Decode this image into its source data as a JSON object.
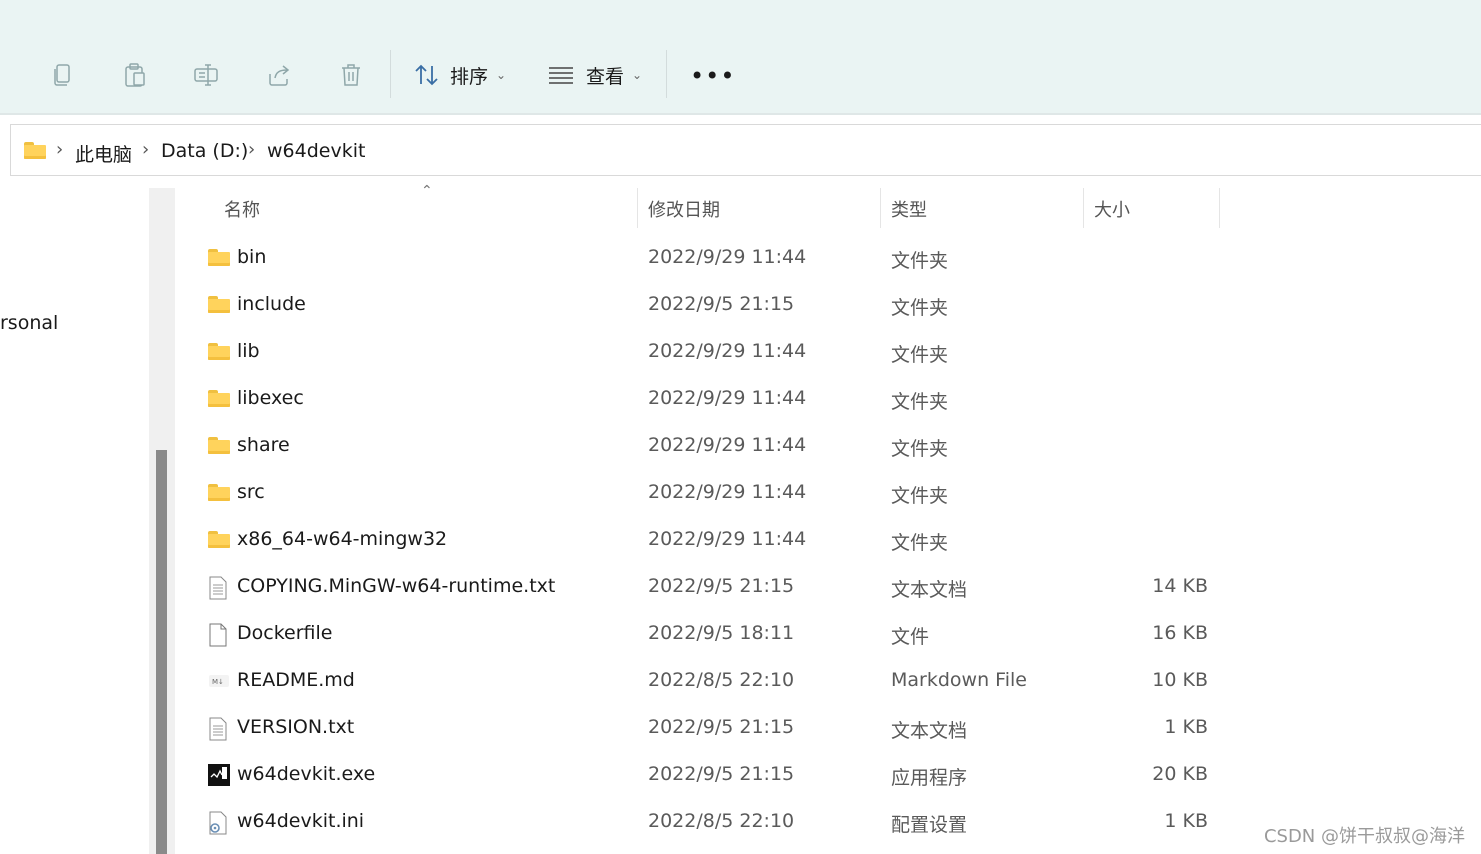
{
  "toolbar": {
    "sort_label": "排序",
    "view_label": "查看",
    "more_label": "•••"
  },
  "breadcrumb": {
    "items": [
      "此电脑",
      "Data (D:)",
      "w64devkit"
    ],
    "separator": "›"
  },
  "nav_pane": {
    "partial_item": "rsonal"
  },
  "columns": {
    "name": "名称",
    "date": "修改日期",
    "type": "类型",
    "size": "大小"
  },
  "files": [
    {
      "name": "bin",
      "date": "2022/9/29 11:44",
      "type": "文件夹",
      "size": "",
      "icon": "folder-icon"
    },
    {
      "name": "include",
      "date": "2022/9/5 21:15",
      "type": "文件夹",
      "size": "",
      "icon": "folder-icon"
    },
    {
      "name": "lib",
      "date": "2022/9/29 11:44",
      "type": "文件夹",
      "size": "",
      "icon": "folder-icon"
    },
    {
      "name": "libexec",
      "date": "2022/9/29 11:44",
      "type": "文件夹",
      "size": "",
      "icon": "folder-icon"
    },
    {
      "name": "share",
      "date": "2022/9/29 11:44",
      "type": "文件夹",
      "size": "",
      "icon": "folder-icon"
    },
    {
      "name": "src",
      "date": "2022/9/29 11:44",
      "type": "文件夹",
      "size": "",
      "icon": "folder-icon"
    },
    {
      "name": "x86_64-w64-mingw32",
      "date": "2022/9/29 11:44",
      "type": "文件夹",
      "size": "",
      "icon": "folder-icon"
    },
    {
      "name": "COPYING.MinGW-w64-runtime.txt",
      "date": "2022/9/5 21:15",
      "type": "文本文档",
      "size": "14 KB",
      "icon": "text-file-icon"
    },
    {
      "name": "Dockerfile",
      "date": "2022/9/5 18:11",
      "type": "文件",
      "size": "16 KB",
      "icon": "blank-file-icon"
    },
    {
      "name": "README.md",
      "date": "2022/8/5 22:10",
      "type": "Markdown File",
      "size": "10 KB",
      "icon": "markdown-file-icon"
    },
    {
      "name": "VERSION.txt",
      "date": "2022/9/5 21:15",
      "type": "文本文档",
      "size": "1 KB",
      "icon": "text-file-icon"
    },
    {
      "name": "w64devkit.exe",
      "date": "2022/9/5 21:15",
      "type": "应用程序",
      "size": "20 KB",
      "icon": "executable-icon"
    },
    {
      "name": "w64devkit.ini",
      "date": "2022/8/5 22:10",
      "type": "配置设置",
      "size": "1 KB",
      "icon": "settings-file-icon"
    }
  ],
  "watermark": "CSDN @饼干叔叔@海洋",
  "colors": {
    "toolbar_bg": "#eaf4f3",
    "folder": "#ffd35c",
    "scroll_thumb": "#8a8a8a"
  }
}
